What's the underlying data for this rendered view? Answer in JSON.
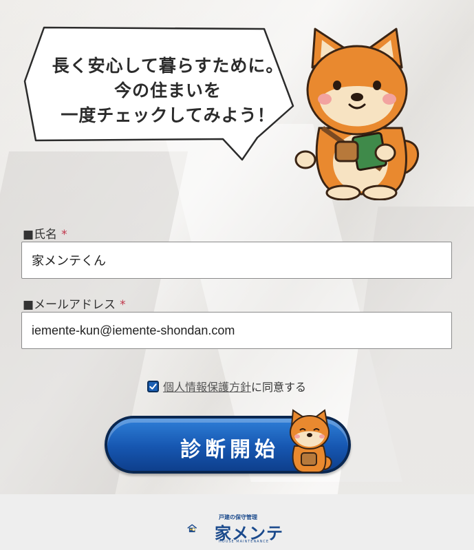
{
  "bubble": {
    "line1": "長く安心して暮らすために。",
    "line2": "今の住まいを",
    "line3": "一度チェックしてみよう！"
  },
  "form": {
    "name_label": "■氏名",
    "name_required": "*",
    "name_value": "家メンテくん",
    "email_label": "■メールアドレス",
    "email_required": "*",
    "email_value": "iemente-kun@iemente-shondan.com",
    "agree_checked": true,
    "policy_link": "個人情報保護方針",
    "agree_text": "に同意する"
  },
  "button": {
    "start_label": "診断開始"
  },
  "footer": {
    "logo_subtitle": "戸建の保守管理",
    "logo_text": "家メンテ",
    "logo_tagline": "HOUSE MAINTENANCE"
  },
  "colors": {
    "accent": "#1656b0",
    "required": "#c0354a",
    "mascot": "#e9892f"
  }
}
